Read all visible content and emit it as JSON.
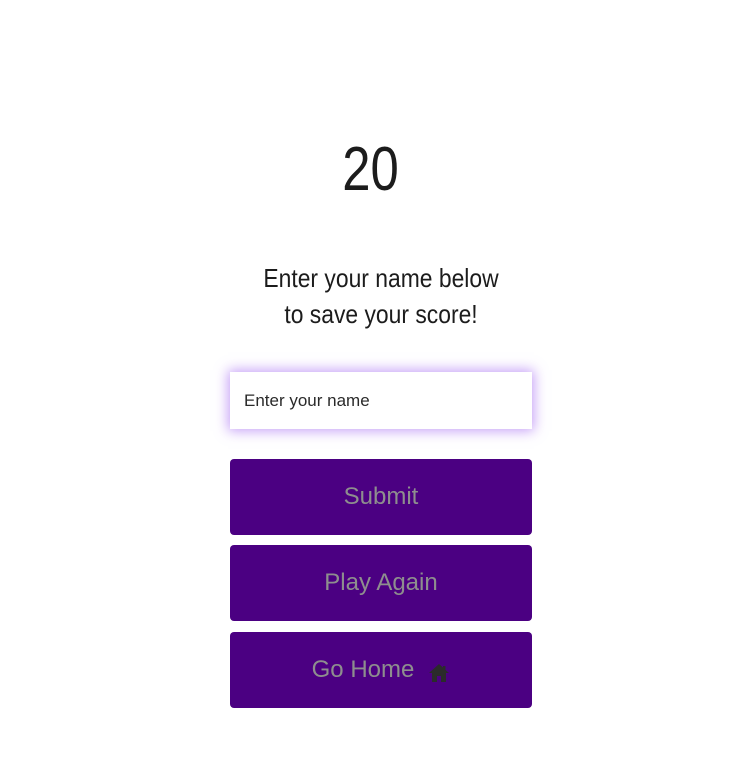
{
  "score": {
    "value": "20"
  },
  "prompt": {
    "text": "Enter your name below to save your score!"
  },
  "name_input": {
    "placeholder": "Enter your name",
    "value": ""
  },
  "buttons": {
    "submit_label": "Submit",
    "play_again_label": "Play Again",
    "go_home_label": "Go Home",
    "go_home_icon": "home-icon"
  },
  "colors": {
    "button_bg": "#4b0082",
    "button_text": "#8e8e8e",
    "input_glow": "#9650f0",
    "text": "#1c1c1c"
  }
}
